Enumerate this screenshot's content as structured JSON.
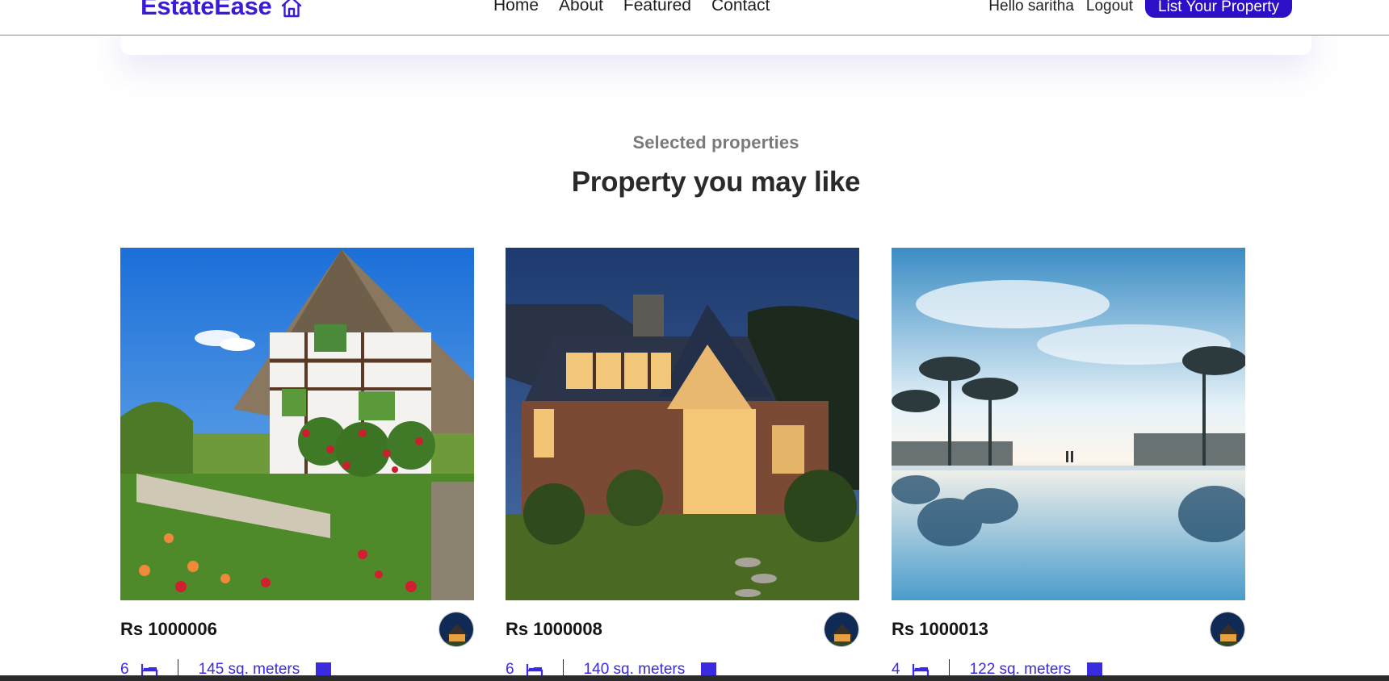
{
  "brand": {
    "name": "EstateEase",
    "icon": "house-outline-icon",
    "color": "#3a1bd6"
  },
  "nav": {
    "links": [
      "Home",
      "About",
      "Featured",
      "Contact"
    ]
  },
  "user": {
    "greeting": "Hello saritha",
    "logout": "Logout",
    "cta": "List Your Property"
  },
  "section": {
    "eyebrow": "Selected properties",
    "title": "Property you may like"
  },
  "properties": [
    {
      "price": "Rs 1000006",
      "beds": "6",
      "area": "145 sq. meters",
      "image": "cottage-photo"
    },
    {
      "price": "Rs 1000008",
      "beds": "6",
      "area": "140 sq. meters",
      "image": "modern-house-dusk-photo"
    },
    {
      "price": "Rs 1000013",
      "beds": "4",
      "area": "122 sq. meters",
      "image": "infinity-pool-photo"
    }
  ],
  "colors": {
    "accent": "#2c0fc7",
    "meta": "#3b2be0"
  }
}
